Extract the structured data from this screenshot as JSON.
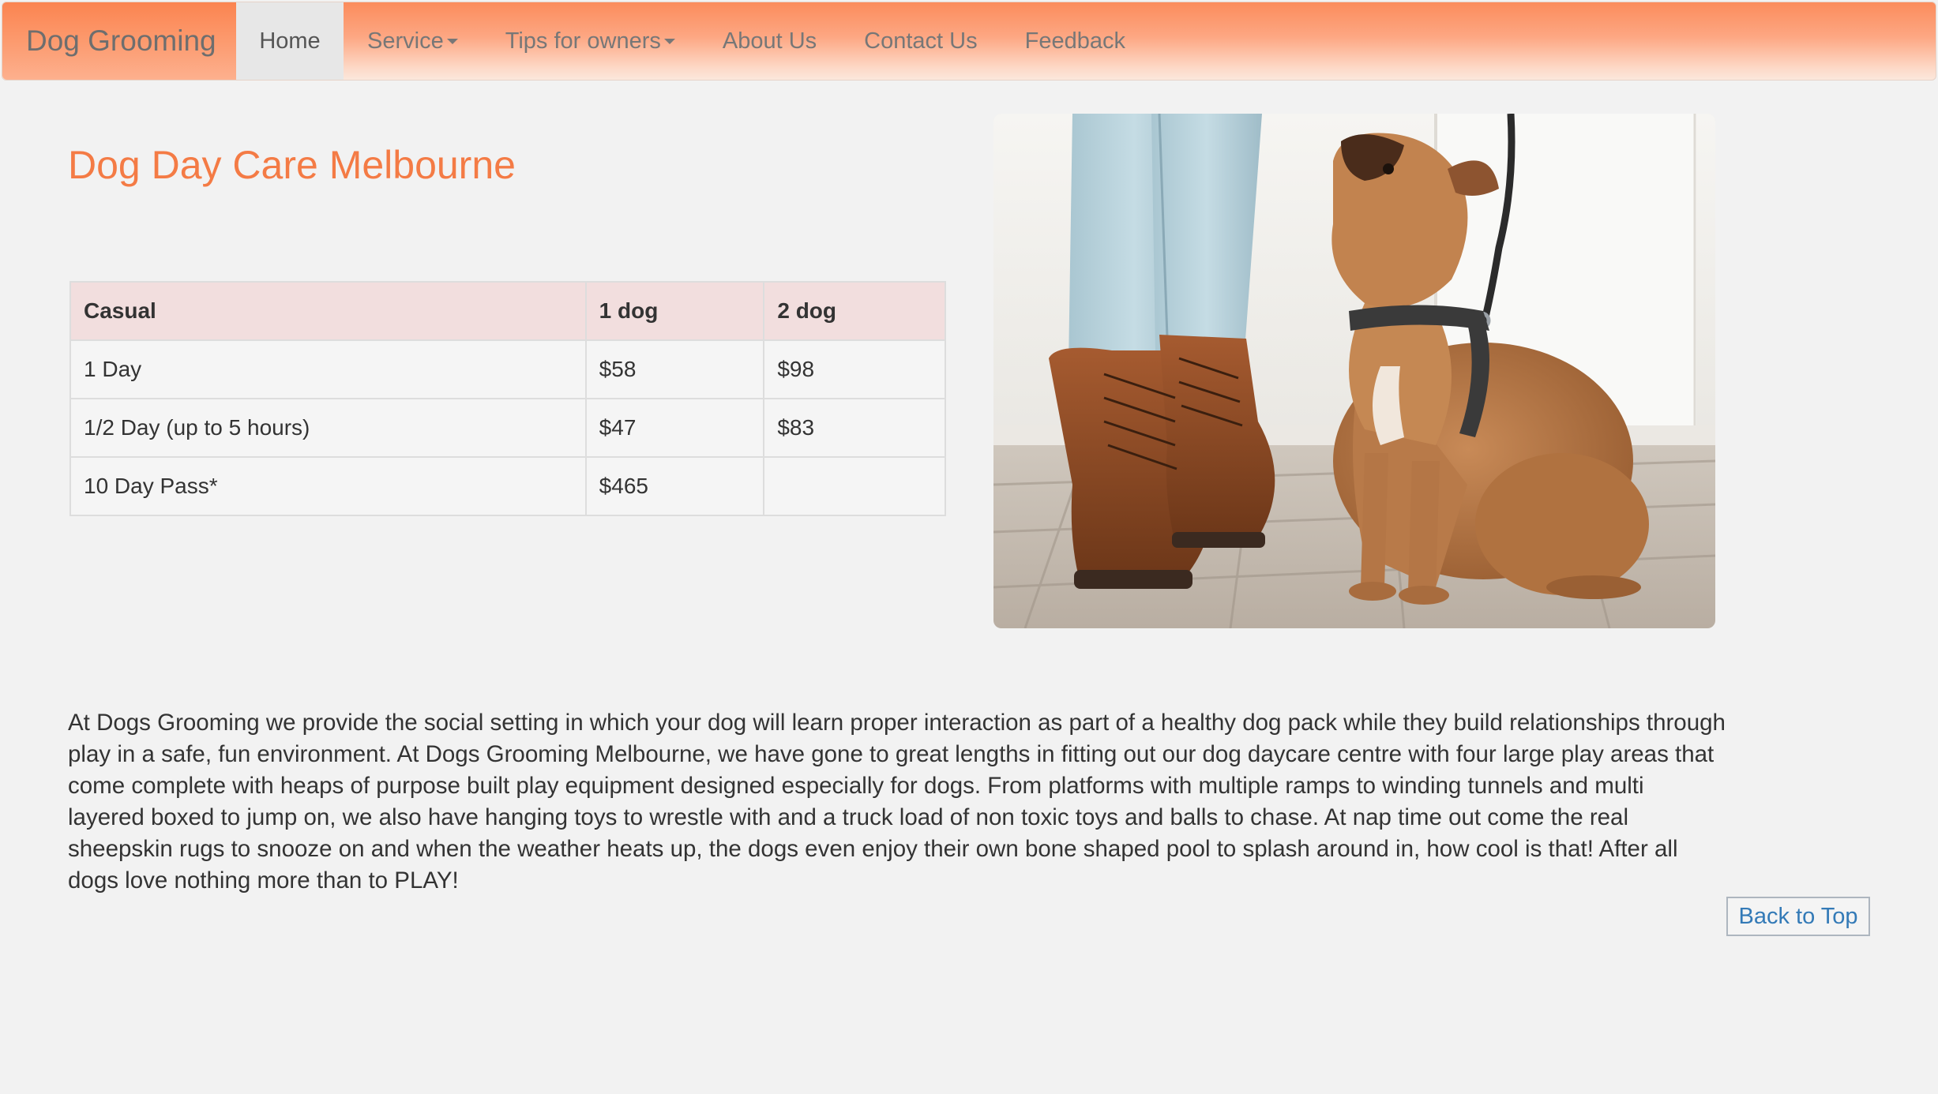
{
  "navbar": {
    "brand": "Dog Grooming",
    "items": [
      {
        "label": "Home",
        "active": true,
        "dropdown": false
      },
      {
        "label": "Service",
        "active": false,
        "dropdown": true
      },
      {
        "label": "Tips for owners",
        "active": false,
        "dropdown": true
      },
      {
        "label": "About Us",
        "active": false,
        "dropdown": false
      },
      {
        "label": "Contact Us",
        "active": false,
        "dropdown": false
      },
      {
        "label": "Feedback",
        "active": false,
        "dropdown": false
      }
    ]
  },
  "main": {
    "title": "Dog Day Care Melbourne",
    "table": {
      "headers": [
        "Casual",
        "1 dog",
        "2 dog"
      ],
      "rows": [
        [
          "1 Day",
          "$58",
          "$98"
        ],
        [
          "1/2 Day (up to 5 hours)",
          "$47",
          "$83"
        ],
        [
          "10 Day Pass*",
          "$465",
          ""
        ]
      ]
    },
    "description": "At Dogs Grooming we provide the social setting in which your dog will learn proper interaction as part of a healthy dog pack while they build relationships through play in a safe, fun environment. At Dogs Grooming Melbourne, we have gone to great lengths in fitting out our dog daycare centre with four large play areas that come complete with heaps of purpose built play equipment designed especially for dogs. From platforms with multiple ramps to winding tunnels and multi layered boxed to jump on, we also have hanging toys to wrestle with and a truck load of non toxic toys and balls to chase. At nap time out come the real sheepskin rugs to snooze on and when the weather heats up, the dogs even enjoy their own bone shaped pool to splash around in, how cool is that! After all dogs love nothing more than to PLAY!",
    "back_to_top": "Back to Top"
  },
  "colors": {
    "accent": "#f47b45",
    "link": "#337ab7",
    "table_header_bg": "#f2dede"
  }
}
